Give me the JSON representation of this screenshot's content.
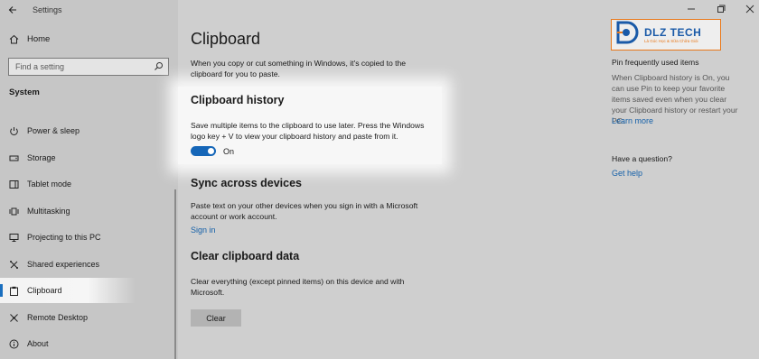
{
  "window": {
    "title": "Settings"
  },
  "sidebar": {
    "home_label": "Home",
    "search_placeholder": "Find a setting",
    "section_title": "System",
    "items": [
      {
        "label": "Power & sleep",
        "icon": "power-icon"
      },
      {
        "label": "Storage",
        "icon": "storage-icon"
      },
      {
        "label": "Tablet mode",
        "icon": "tablet-icon"
      },
      {
        "label": "Multitasking",
        "icon": "multitasking-icon"
      },
      {
        "label": "Projecting to this PC",
        "icon": "projector-icon"
      },
      {
        "label": "Shared experiences",
        "icon": "shared-icon"
      },
      {
        "label": "Clipboard",
        "icon": "clipboard-icon",
        "active": true
      },
      {
        "label": "Remote Desktop",
        "icon": "remote-icon"
      },
      {
        "label": "About",
        "icon": "info-icon"
      }
    ]
  },
  "main": {
    "title": "Clipboard",
    "intro": "When you copy or cut something in Windows, it's copied to the clipboard for you to paste.",
    "history": {
      "heading": "Clipboard history",
      "text": "Save multiple items to the clipboard to use later. Press the Windows logo key + V to view your clipboard history and paste from it.",
      "toggle_state": "On"
    },
    "sync": {
      "heading": "Sync across devices",
      "text": "Paste text on your other devices when you sign in with a Microsoft account or work account.",
      "link": "Sign in"
    },
    "clear": {
      "heading": "Clear clipboard data",
      "text": "Clear everything (except pinned items) on this device and with Microsoft.",
      "button": "Clear"
    }
  },
  "right_panel": {
    "pin_title": "Pin frequently used items",
    "pin_text": "When Clipboard history is On, you can use Pin to keep your favorite items saved even when you clear your Clipboard history or restart your PC.",
    "learn_more": "Learn more",
    "question": "Have a question?",
    "get_help": "Get help"
  },
  "logo": {
    "name": "DLZ TECH",
    "tagline": "Là Góc Học & Sữa Chữa Giỏi"
  },
  "colors": {
    "accent": "#1566b8",
    "logo_border": "#e8781a",
    "link": "#1560a8"
  }
}
